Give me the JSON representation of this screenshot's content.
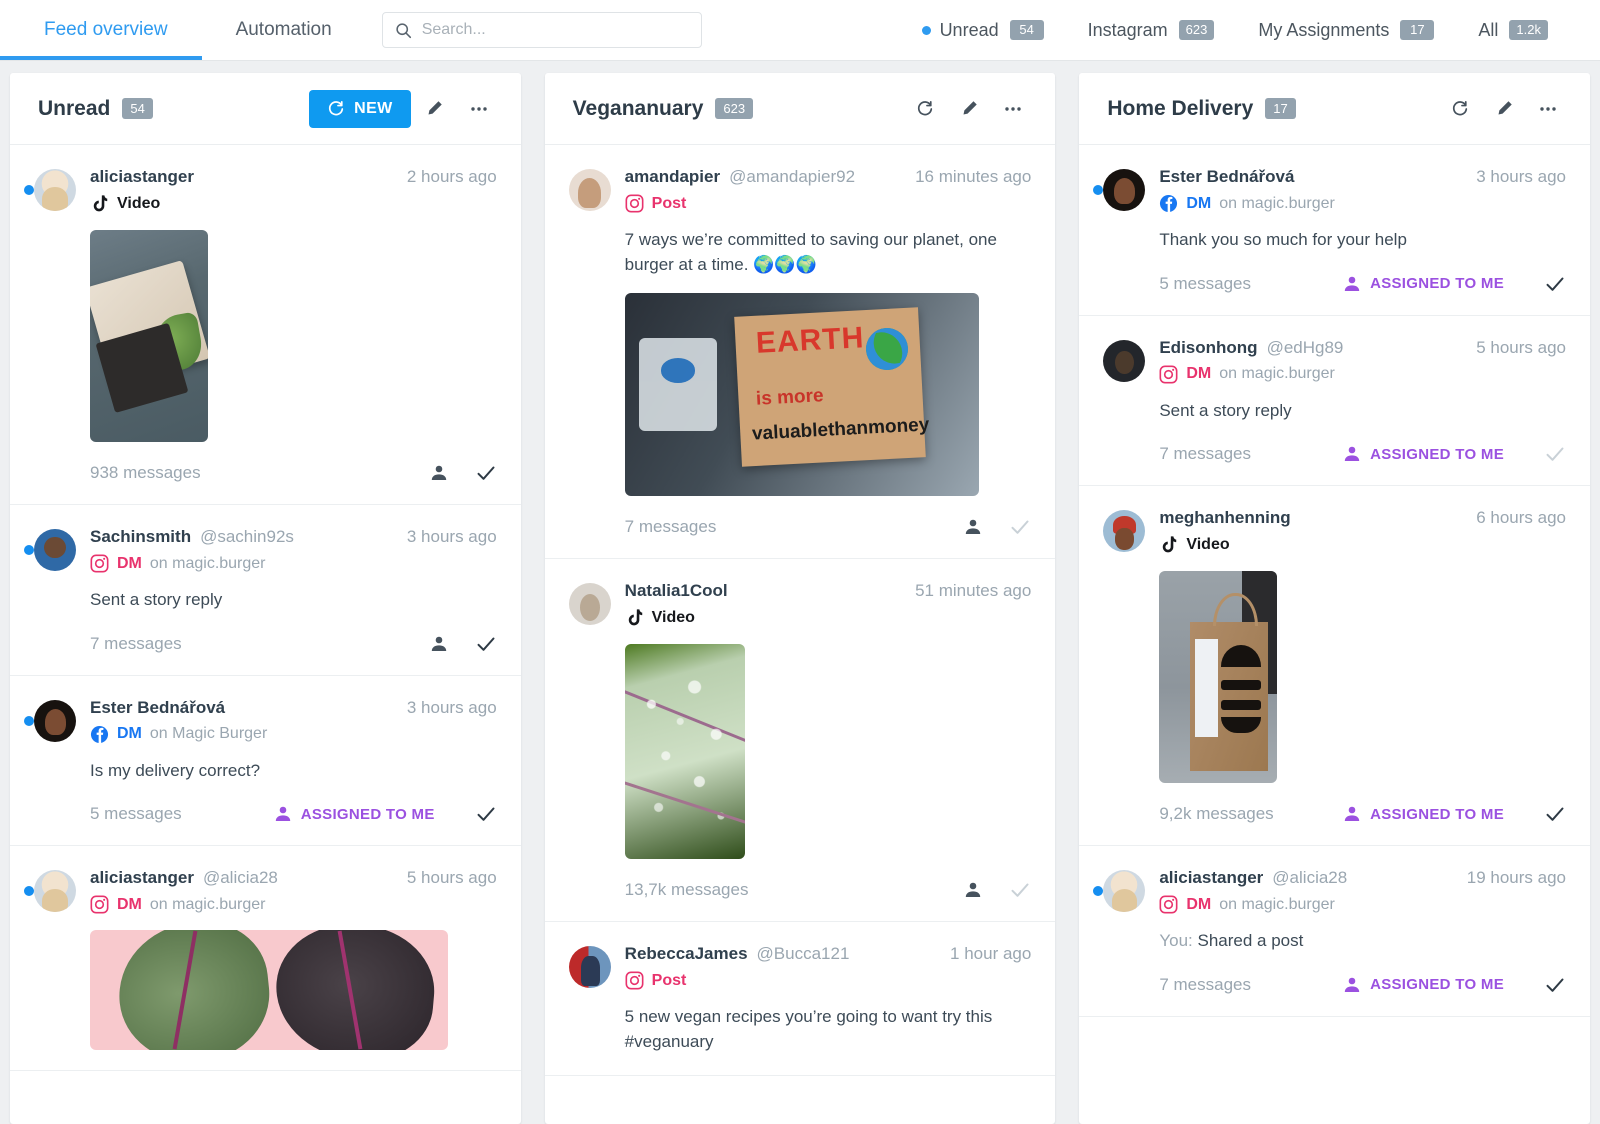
{
  "topbar": {
    "tabs": [
      {
        "label": "Feed overview",
        "active": true
      },
      {
        "label": "Automation",
        "active": false
      }
    ],
    "search": {
      "placeholder": "Search...",
      "value": "",
      "icon": "search-icon"
    },
    "filters": [
      {
        "label": "Unread",
        "count": "54",
        "dot": true
      },
      {
        "label": "Instagram",
        "count": "623",
        "dot": false
      },
      {
        "label": "My Assignments",
        "count": "17",
        "dot": false
      },
      {
        "label": "All",
        "count": "1.2k",
        "dot": false
      }
    ]
  },
  "colors": {
    "accent_blue": "#2f9bf0",
    "new_button": "#0f9af0",
    "pill_gray": "#93a2ae",
    "assigned_purple": "#9b51e0",
    "instagram_pink": "#e8336d",
    "facebook_blue": "#1877f2",
    "unread_dot": "#158ef0"
  },
  "columns": [
    {
      "title": "Unread",
      "count": "54",
      "new_button": {
        "label": "NEW",
        "icon": "refresh-icon"
      },
      "actions": [
        "edit-icon",
        "more-icon"
      ],
      "items": [
        {
          "unread": true,
          "avatar": "av-alicia",
          "username": "aliciastanger",
          "handle": "",
          "time": "2 hours ago",
          "source_icon": "tiktok-icon",
          "source_label": "Video",
          "source_label_class": "tt",
          "source_on": "",
          "preview": "",
          "thumb": "art-food",
          "thumb_class": "portrait",
          "messages": "938 messages",
          "assigned": null,
          "icons": [
            "person-icon",
            "check-icon"
          ],
          "check_muted": false
        },
        {
          "unread": true,
          "avatar": "av-sachin",
          "username": "Sachinsmith",
          "handle": "@sachin92s",
          "time": "3 hours ago",
          "source_icon": "instagram-icon",
          "source_label": "DM",
          "source_label_class": "ig",
          "source_on": "on magic.burger",
          "preview": "Sent a story reply",
          "thumb": null,
          "thumb_class": "",
          "messages": "7 messages",
          "assigned": null,
          "icons": [
            "person-icon",
            "check-icon"
          ],
          "check_muted": false
        },
        {
          "unread": true,
          "avatar": "av-ester",
          "username": "Ester Bednářová",
          "handle": "",
          "time": "3 hours ago",
          "source_icon": "facebook-icon",
          "source_label": "DM",
          "source_label_class": "fb",
          "source_on": "on Magic Burger",
          "preview": "Is my delivery correct?",
          "thumb": null,
          "thumb_class": "",
          "messages": "5 messages",
          "assigned": "ASSIGNED TO ME",
          "icons": [
            "check-icon"
          ],
          "check_muted": false
        },
        {
          "unread": true,
          "avatar": "av-alicia",
          "username": "aliciastanger",
          "handle": "@alicia28",
          "time": "5 hours ago",
          "source_icon": "instagram-icon",
          "source_label": "DM",
          "source_label_class": "ig",
          "source_on": "on magic.burger",
          "preview": "",
          "thumb": "art-pinkleaf",
          "thumb_class": "banner",
          "messages": "",
          "assigned": null,
          "icons": [],
          "check_muted": false
        }
      ]
    },
    {
      "title": "Vegananuary",
      "count": "623",
      "new_button": null,
      "actions": [
        "refresh-icon",
        "edit-icon",
        "more-icon"
      ],
      "items": [
        {
          "unread": false,
          "avatar": "av-amanda",
          "username": "amandapier",
          "handle": "@amandapier92",
          "time": "16 minutes ago",
          "source_icon": "instagram-icon",
          "source_label": "Post",
          "source_label_class": "ig",
          "source_on": "",
          "preview": "7 ways we’re committed to saving our planet, one burger at a time. 🌍🌍🌍",
          "thumb": "art-sign",
          "thumb_class": "wide-img",
          "messages": "7 messages",
          "assigned": null,
          "icons": [
            "person-icon",
            "check-icon"
          ],
          "check_muted": true
        },
        {
          "unread": false,
          "avatar": "av-natalia",
          "username": "Natalia1Cool",
          "handle": "",
          "time": "51 minutes ago",
          "source_icon": "tiktok-icon",
          "source_label": "Video",
          "source_label_class": "tt",
          "source_on": "",
          "preview": "",
          "thumb": "art-leaf",
          "thumb_class": "portrait wide",
          "messages": "13,7k messages",
          "assigned": null,
          "icons": [
            "person-icon",
            "check-icon"
          ],
          "check_muted": true
        },
        {
          "unread": false,
          "avatar": "av-rebecca",
          "username": "RebeccaJames",
          "handle": "@Bucca121",
          "time": "1 hour ago",
          "source_icon": "instagram-icon",
          "source_label": "Post",
          "source_label_class": "ig",
          "source_on": "",
          "preview": "5 new vegan recipes you’re going to want try this #veganuary",
          "thumb": null,
          "thumb_class": "",
          "messages": "",
          "assigned": null,
          "icons": [],
          "check_muted": false
        }
      ]
    },
    {
      "title": "Home Delivery",
      "count": "17",
      "new_button": null,
      "actions": [
        "refresh-icon",
        "edit-icon",
        "more-icon"
      ],
      "items": [
        {
          "unread": true,
          "avatar": "av-ester",
          "username": "Ester Bednářová",
          "handle": "",
          "time": "3 hours ago",
          "source_icon": "facebook-icon",
          "source_label": "DM",
          "source_label_class": "fb",
          "source_on": "on magic.burger",
          "preview": "Thank you so much for your help",
          "thumb": null,
          "thumb_class": "",
          "messages": "5 messages",
          "assigned": "ASSIGNED TO ME",
          "icons": [
            "check-icon"
          ],
          "check_muted": false
        },
        {
          "unread": false,
          "avatar": "av-edison",
          "username": "Edisonhong",
          "handle": "@edHg89",
          "time": "5 hours ago",
          "source_icon": "instagram-icon",
          "source_label": "DM",
          "source_label_class": "ig",
          "source_on": "on magic.burger",
          "preview": "Sent a story reply",
          "thumb": null,
          "thumb_class": "",
          "messages": "7 messages",
          "assigned": "ASSIGNED TO ME",
          "icons": [
            "check-icon"
          ],
          "check_muted": true
        },
        {
          "unread": false,
          "avatar": "av-meghan",
          "username": "meghanhenning",
          "handle": "",
          "time": "6 hours ago",
          "source_icon": "tiktok-icon",
          "source_label": "Video",
          "source_label_class": "tt",
          "source_on": "",
          "preview": "",
          "thumb": "art-bag",
          "thumb_class": "bag",
          "messages": "9,2k messages",
          "assigned": "ASSIGNED TO ME",
          "icons": [
            "check-icon"
          ],
          "check_muted": false
        },
        {
          "unread": true,
          "avatar": "av-alicia",
          "username": "aliciastanger",
          "handle": "@alicia28",
          "time": "19 hours ago",
          "source_icon": "instagram-icon",
          "source_label": "DM",
          "source_label_class": "ig",
          "source_on": "on magic.burger",
          "preview_prefix": "You: ",
          "preview": "Shared a post",
          "thumb": null,
          "thumb_class": "",
          "messages": "7 messages",
          "assigned": "ASSIGNED TO ME",
          "icons": [
            "check-icon"
          ],
          "check_muted": false
        }
      ]
    }
  ]
}
